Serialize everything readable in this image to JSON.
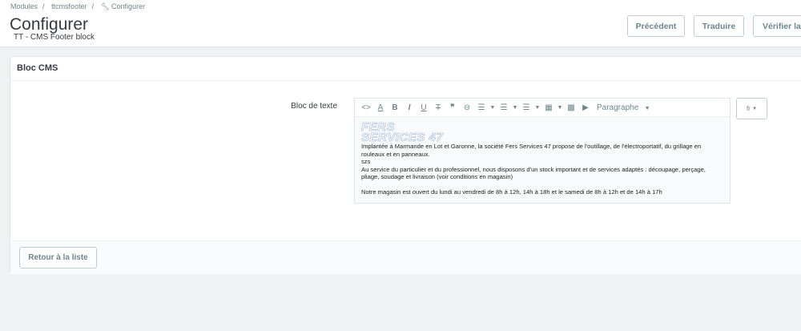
{
  "breadcrumb": [
    "Modules",
    "ttcmsfooter",
    "Configurer"
  ],
  "header": {
    "title": "Configurer",
    "subtitle": "TT - CMS Footer block",
    "buttons": [
      "Précédent",
      "Traduire",
      "Vérifier la traduction"
    ]
  },
  "panel": {
    "title": "Bloc CMS",
    "field_label": "Bloc de texte",
    "language": "fr",
    "back_label": "Retour à la liste"
  },
  "editor": {
    "format": "Paragraphe",
    "logo": [
      "FERS",
      "SERVICES 47"
    ],
    "lines": [
      "Implantée à Marmande en Lot et Garonne, la société Fers Services 47 propose de l'outillage, de l'électroportatif, du grillage en rouleaux et en panneaux.",
      "szs",
      "Au service du particulier et du professionnel, nous disposons d'un stock important et de services adaptés : découpage, perçage, pliage, soudage et livraison (voir conditions en magasin)",
      "",
      "Notre magasin est ouvert du lundi au vendredi de 8h à 12h, 14h à 18h et le samedi de 8h à 12h et de 14h à 17h"
    ]
  }
}
